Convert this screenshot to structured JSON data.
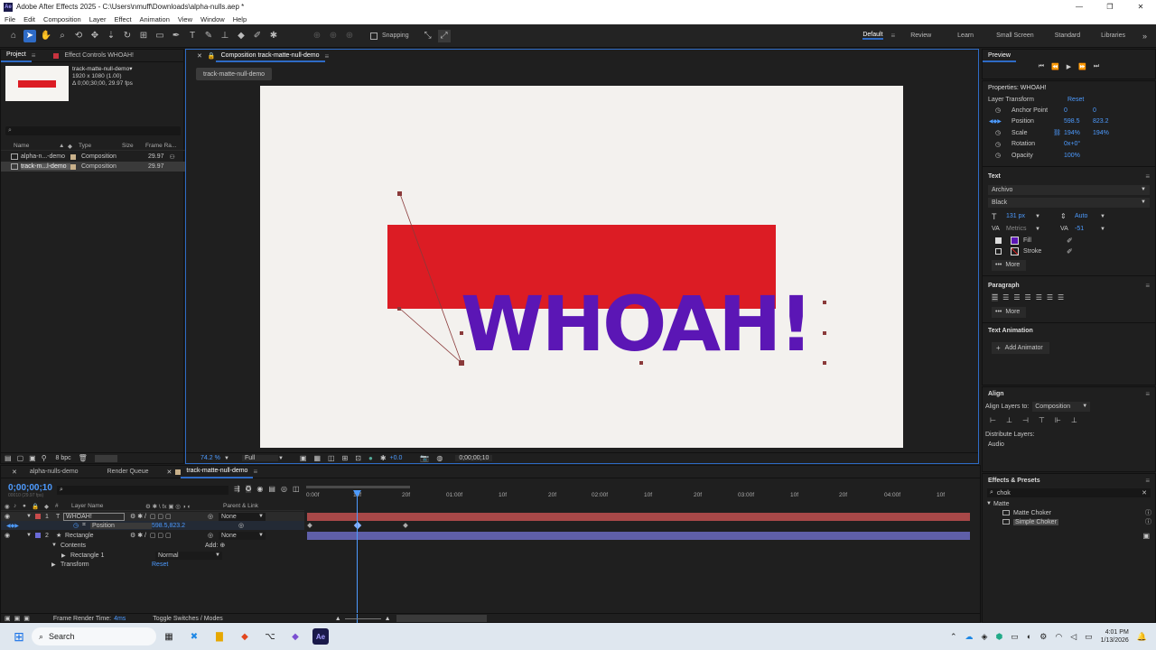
{
  "app_title": "Adobe After Effects 2025 - C:\\Users\\nmuff\\Downloads\\alpha-nulls.aep *",
  "app_icon": "Ae",
  "window_controls": {
    "minimize": "—",
    "maximize": "❐",
    "close": "✕"
  },
  "menu": [
    "File",
    "Edit",
    "Composition",
    "Layer",
    "Effect",
    "Animation",
    "View",
    "Window",
    "Help"
  ],
  "toolbar": {
    "snapping_label": "Snapping"
  },
  "workspaces": [
    "Default",
    "Review",
    "Learn",
    "Small Screen",
    "Standard",
    "Libraries"
  ],
  "project_panel": {
    "tabs": [
      "Project",
      "Effect Controls WHOAH!"
    ],
    "comp_name": "track-matte-null-demo▾",
    "comp_size": "1920 x 1080 (1.00)",
    "comp_duration": "Δ 0;00;30;00, 29.97 fps",
    "columns": {
      "name": "Name",
      "type": "Type",
      "size": "Size",
      "frame_rate": "Frame Ra..."
    },
    "items": [
      {
        "name": "alpha-n...-demo",
        "type": "Composition",
        "fps": "29.97"
      },
      {
        "name": "track-m...l-demo",
        "type": "Composition",
        "fps": "29.97"
      }
    ],
    "bpc": "8 bpc"
  },
  "comp_panel": {
    "tab": "Composition track-matte-null-demo",
    "subtab": "track-matte-null-demo",
    "text": "WHOAH!",
    "zoom": "74.2 %",
    "resolution": "Full",
    "exposure": "+0.0",
    "timecode": "0;00;00;10",
    "colors": {
      "bg": "#f3f1ee",
      "rect": "#dc1c24",
      "text": "#5b16b5"
    }
  },
  "preview": {
    "title": "Preview"
  },
  "properties": {
    "title": "Properties: WHOAH!",
    "layer_transform": "Layer Transform",
    "reset": "Reset",
    "rows": [
      {
        "label": "Anchor Point",
        "v1": "0",
        "v2": "0"
      },
      {
        "label": "Position",
        "v1": "598.5",
        "v2": "823.2"
      },
      {
        "label": "Scale",
        "v1": "194%",
        "v2": "194%"
      },
      {
        "label": "Rotation",
        "v1": "0x+0°",
        "v2": ""
      },
      {
        "label": "Opacity",
        "v1": "100%",
        "v2": ""
      }
    ],
    "text_title": "Text",
    "font": "Archivo",
    "style": "Black",
    "font_size": "131 px",
    "leading": "Auto",
    "kerning": "Metrics",
    "tracking": "-51",
    "fill": "Fill",
    "stroke": "Stroke",
    "more": "More",
    "paragraph_title": "Paragraph",
    "text_animation_title": "Text Animation",
    "add_animator": "Add Animator",
    "fill_color": "#5b16b5"
  },
  "align": {
    "title": "Align",
    "align_to_label": "Align Layers to:",
    "align_to_value": "Composition",
    "distribute_label": "Distribute Layers:",
    "audio": "Audio"
  },
  "effects": {
    "title": "Effects & Presets",
    "search": "chok",
    "category": "Matte",
    "items": [
      "Matte Choker",
      "Simple Choker"
    ]
  },
  "timeline": {
    "tabs": [
      "alpha-nulls-demo",
      "Render Queue",
      "track-matte-null-demo"
    ],
    "timecode": "0;00;00;10",
    "timecode_sub": "00010 (29.97 fps)",
    "col_layer_name": "Layer Name",
    "col_parent": "Parent & Link",
    "ruler": [
      "0:00f",
      "10f",
      "20f",
      "01:00f",
      "10f",
      "20f",
      "02:00f",
      "10f",
      "20f",
      "03:00f",
      "10f",
      "20f",
      "04:00f",
      "10f"
    ],
    "layers": [
      {
        "num": "1",
        "type": "T",
        "name": "WHOAH!",
        "parent": "None",
        "color": "#c84b4b"
      },
      {
        "num": "2",
        "type": "★",
        "name": "Rectangle",
        "parent": "None",
        "color": "#6a6ad6"
      }
    ],
    "position_label": "Position",
    "position_value": "598.5,823.2",
    "contents": "Contents",
    "add": "Add:",
    "rect1": "Rectangle 1",
    "blend": "Normal",
    "transform": "Transform",
    "reset": "Reset",
    "render_time_label": "Frame Render Time:",
    "render_time_value": "4ms",
    "toggle": "Toggle Switches / Modes"
  },
  "taskbar": {
    "search": "Search",
    "time": "4:01 PM",
    "date": "1/13/2026"
  }
}
